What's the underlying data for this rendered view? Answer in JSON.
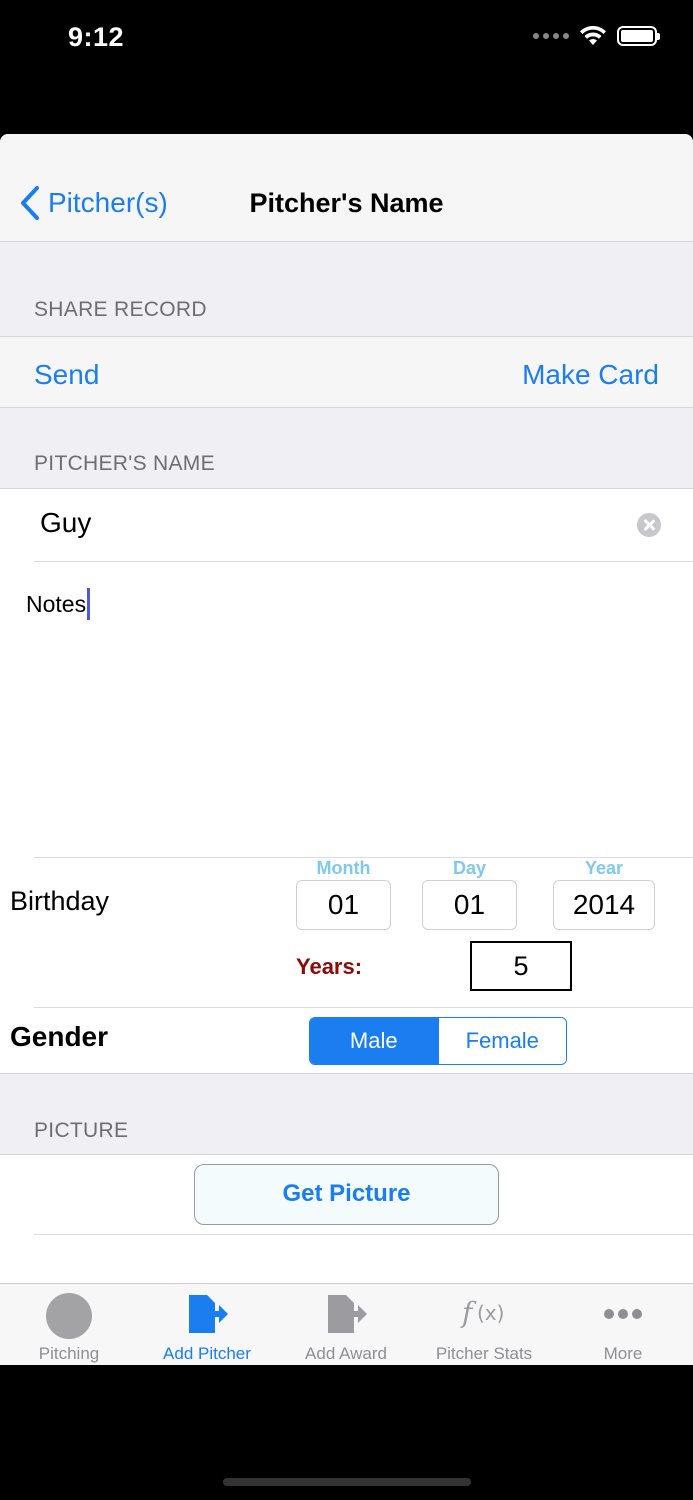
{
  "status_bar": {
    "time": "9:12"
  },
  "nav": {
    "back_label": "Pitcher(s)",
    "title": "Pitcher's Name"
  },
  "sections": {
    "share_record": "SHARE RECORD",
    "pitchers_name": "PITCHER'S NAME",
    "picture": "PICTURE"
  },
  "share": {
    "send_label": "Send",
    "make_card_label": "Make Card"
  },
  "name_field": {
    "value": "Guy"
  },
  "notes": {
    "value": "Notes"
  },
  "birthday": {
    "label": "Birthday",
    "month_caption": "Month",
    "day_caption": "Day",
    "year_caption": "Year",
    "month": "01",
    "day": "01",
    "year": "2014",
    "years_label": "Years:",
    "years": "5"
  },
  "gender": {
    "label": "Gender",
    "options": [
      "Male",
      "Female"
    ],
    "selected": "Male"
  },
  "picture": {
    "button_label": "Get Picture"
  },
  "tabs": [
    {
      "label": "Pitching",
      "icon": "baseball-icon",
      "active": false
    },
    {
      "label": "Add Pitcher",
      "icon": "add-pitcher-icon",
      "active": true
    },
    {
      "label": "Add Award",
      "icon": "add-award-icon",
      "active": false
    },
    {
      "label": "Pitcher Stats",
      "icon": "function-icon",
      "active": false
    },
    {
      "label": "More",
      "icon": "more-icon",
      "active": false
    }
  ],
  "colors": {
    "accent": "#1a7ef0",
    "section_bg": "#efeff4",
    "years_label": "#8b0a0a",
    "date_caption": "#7ec9ef"
  }
}
